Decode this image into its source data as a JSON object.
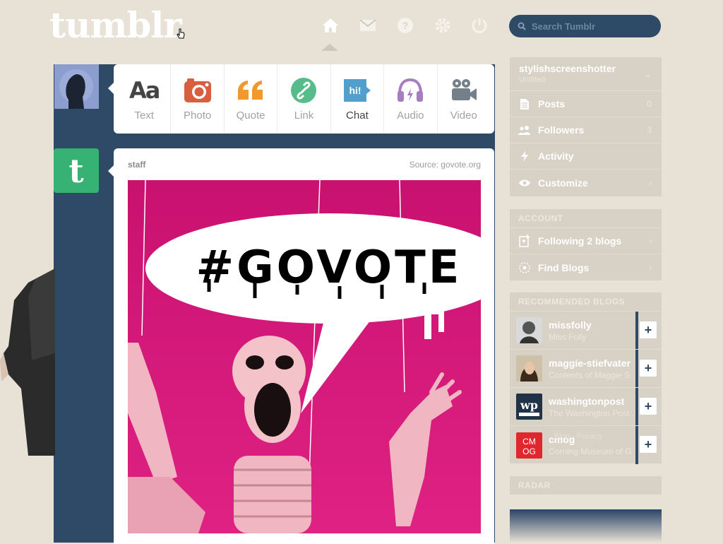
{
  "header": {
    "logo_text": "tumblr",
    "search_placeholder": "Search Tumblr",
    "nav_icons": [
      "home-icon",
      "envelope-icon",
      "help-icon",
      "gear-icon",
      "power-icon"
    ]
  },
  "post_types": [
    {
      "label": "Text",
      "icon": "text-icon",
      "color": "#444444"
    },
    {
      "label": "Photo",
      "icon": "camera-icon",
      "color": "#d95e40"
    },
    {
      "label": "Quote",
      "icon": "quote-icon",
      "color": "#f2992e"
    },
    {
      "label": "Link",
      "icon": "link-icon",
      "color": "#56bc8a"
    },
    {
      "label": "Chat",
      "icon": "chat-icon",
      "color": "#529ecc"
    },
    {
      "label": "Audio",
      "icon": "headphones-icon",
      "color": "#a77dc2"
    },
    {
      "label": "Video",
      "icon": "video-camera-icon",
      "color": "#748089"
    }
  ],
  "post": {
    "author": "staff",
    "source": "Source: govote.org",
    "image_text": "#GOVOTE"
  },
  "sidebar": {
    "blog_name": "stylishscreenshotter",
    "blog_title": "Untitled",
    "rows": [
      {
        "label": "Posts",
        "count": "0",
        "icon": "document-icon"
      },
      {
        "label": "Followers",
        "count": "3",
        "icon": "people-icon"
      },
      {
        "label": "Activity",
        "count": "",
        "icon": "lightning-icon"
      },
      {
        "label": "Customize",
        "count": "›",
        "icon": "eye-icon"
      }
    ],
    "account_title": "ACCOUNT",
    "account_rows": [
      {
        "label": "Following 2 blogs",
        "icon": "following-icon"
      },
      {
        "label": "Find Blogs",
        "icon": "find-icon"
      }
    ],
    "recommended_title": "RECOMMENDED BLOGS",
    "recommended": [
      {
        "name": "missfolly",
        "title": "Miss Folly",
        "thumb_color": "#777777"
      },
      {
        "name": "maggie-stiefvater",
        "title": "Contents of Maggie S",
        "thumb_color": "#6a5b49"
      },
      {
        "name": "washingtonpost",
        "title": "The Washington Post",
        "thumb_color": "#1f3247"
      },
      {
        "name": "cmog",
        "title": "Corning Museum of G",
        "thumb_color": "#e0272e"
      }
    ],
    "footer_text": "Blog · Privacy",
    "radar_title": "RADAR"
  },
  "colors": {
    "background": "#e7e1d6",
    "navy": "#2e4a67",
    "magenta": "#d9137f"
  }
}
